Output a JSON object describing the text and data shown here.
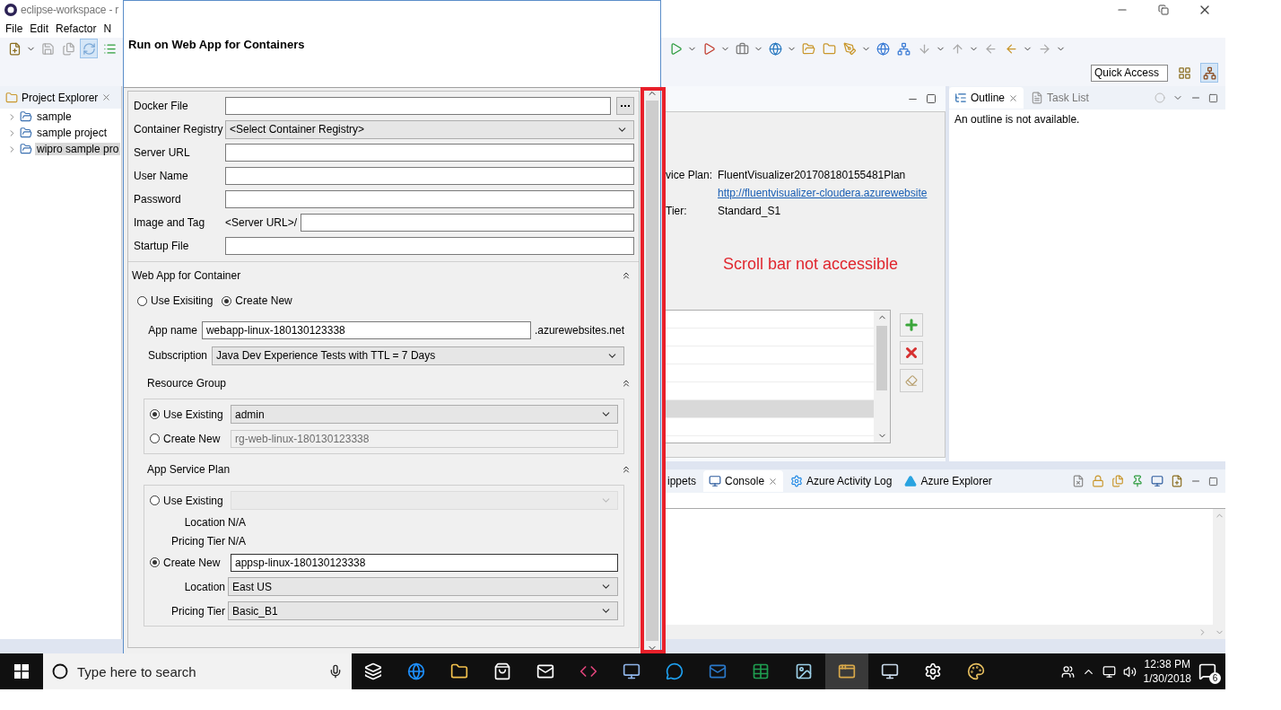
{
  "eclipse": {
    "title": "eclipse-workspace - r",
    "menu": [
      "File",
      "Edit",
      "Refactor",
      "N"
    ],
    "quick_access": "Quick Access",
    "project_explorer": {
      "title": "Project Explorer",
      "items": [
        {
          "label": "sample",
          "selected": false
        },
        {
          "label": "sample project",
          "selected": false
        },
        {
          "label": "wipro sample pro",
          "selected": true
        }
      ]
    },
    "editor": {
      "details": [
        {
          "label": "vice Plan:",
          "value": "FluentVisualizer201708180155481Plan",
          "kind": "text"
        },
        {
          "value": "http://fluentvisualizer-cloudera.azurewebsite",
          "kind": "link"
        },
        {
          "label": "Tier:",
          "value": "Standard_S1",
          "kind": "text"
        }
      ],
      "table_rows": [
        {
          "selected": false
        },
        {
          "selected": false
        },
        {
          "selected": false
        },
        {
          "selected": false
        },
        {
          "selected": false
        },
        {
          "selected": true
        },
        {
          "selected": false
        }
      ]
    },
    "outline": {
      "tabs": [
        {
          "label": "Outline",
          "selected": true
        },
        {
          "label": "Task List",
          "selected": false
        }
      ],
      "message": "An outline is not available."
    },
    "console": {
      "tabs": [
        {
          "label": "ippets",
          "selected": false
        },
        {
          "label": "Console",
          "selected": true
        },
        {
          "label": "Azure Activity Log",
          "selected": false
        },
        {
          "label": "Azure Explorer",
          "selected": false
        }
      ]
    }
  },
  "annotation": {
    "text": "Scroll bar not accessible"
  },
  "dialog": {
    "title": "Run on Web App for Containers",
    "fields": [
      {
        "label": "Docker File",
        "kind": "file"
      },
      {
        "label": "Container Registry",
        "kind": "select",
        "value": "<Select Container Registry>"
      },
      {
        "label": "Server URL",
        "kind": "text"
      },
      {
        "label": "User Name",
        "kind": "text"
      },
      {
        "label": "Password",
        "kind": "text"
      },
      {
        "label": "Image and Tag",
        "kind": "prefixed",
        "prefix": "<Server URL>/"
      },
      {
        "label": "Startup File",
        "kind": "text"
      }
    ],
    "web_app": {
      "title": "Web App for Container",
      "expanded": true,
      "modes": [
        {
          "label": "Use Exisiting",
          "selected": false
        },
        {
          "label": "Create New",
          "selected": true
        }
      ],
      "app_name": {
        "label": "App name",
        "value": "webapp-linux-180130123338",
        "suffix": ".azurewebsites.net"
      },
      "subscription": {
        "label": "Subscription",
        "value": "Java Dev Experience Tests with TTL = 7 Days"
      },
      "resource_group": {
        "title": "Resource Group",
        "expanded": true,
        "use_existing": {
          "label": "Use Existing",
          "selected": true,
          "value": "admin"
        },
        "create_new": {
          "label": "Create New",
          "selected": false,
          "value": "rg-web-linux-180130123338"
        }
      },
      "service_plan": {
        "title": "App Service Plan",
        "expanded": true,
        "use_existing": {
          "label": "Use Existing",
          "selected": false
        },
        "details": [
          {
            "label": "Location",
            "value": "N/A"
          },
          {
            "label": "Pricing Tier",
            "value": "N/A"
          }
        ],
        "create_new": {
          "label": "Create New",
          "selected": true,
          "value": "appsp-linux-180130123338"
        },
        "settings": [
          {
            "label": "Location",
            "value": "East US"
          },
          {
            "label": "Pricing Tier",
            "value": "Basic_B1"
          }
        ]
      }
    }
  },
  "taskbar": {
    "search_placeholder": "Type here to search",
    "time": "12:38 PM",
    "date": "1/30/2018",
    "notifications": "6"
  }
}
